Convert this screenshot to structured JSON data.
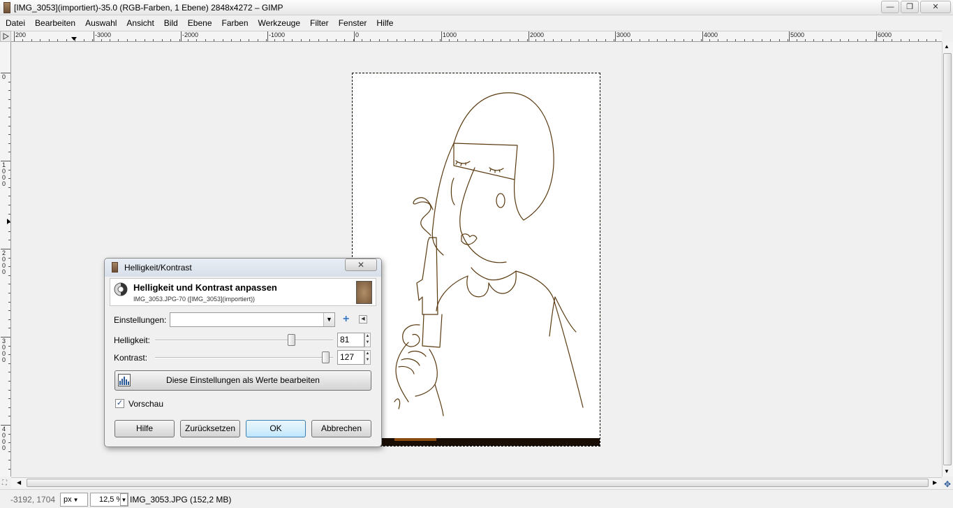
{
  "window": {
    "title": "[IMG_3053](importiert)-35.0 (RGB-Farben, 1 Ebene) 2848x4272 – GIMP",
    "minimize": "—",
    "maximize": "❐",
    "close": "✕"
  },
  "menu": [
    {
      "label": "Datei"
    },
    {
      "label": "Bearbeiten"
    },
    {
      "label": "Auswahl"
    },
    {
      "label": "Ansicht"
    },
    {
      "label": "Bild"
    },
    {
      "label": "Ebene"
    },
    {
      "label": "Farben"
    },
    {
      "label": "Werkzeuge"
    },
    {
      "label": "Filter"
    },
    {
      "label": "Fenster"
    },
    {
      "label": "Hilfe"
    }
  ],
  "ruler_top": [
    "200",
    "-3000",
    "-2000",
    "-1000",
    "0",
    "1000",
    "2000",
    "3000",
    "4000",
    "5000",
    "6000"
  ],
  "ruler_left": [
    "0",
    "1000",
    "2000",
    "3000",
    "4000"
  ],
  "statusbar": {
    "coords": "-3192, 1704",
    "unit": "px",
    "zoom": "12,5 %",
    "file": "IMG_3053.JPG (152,2 MB)"
  },
  "dialog": {
    "title": "Helligkeit/Kontrast",
    "close": "✕",
    "heading": "Helligkeit und Kontrast anpassen",
    "subheading": "IMG_3053.JPG-70 ([IMG_3053](importiert))",
    "settings_label": "Einstellungen:",
    "settings_value": "",
    "brightness_label": "Helligkeit:",
    "brightness_value": "81",
    "brightness_level": 0.81,
    "contrast_label": "Kontrast:",
    "contrast_value": "127",
    "contrast_level": 1.0,
    "edit_values_label": "Diese Einstellungen als Werte bearbeiten",
    "preview_label": "Vorschau",
    "preview_checked": true,
    "buttons": {
      "help": "Hilfe",
      "reset": "Zurücksetzen",
      "ok": "OK",
      "cancel": "Abbrechen"
    }
  },
  "colors": {
    "selection_marching_ants": "#b69b00",
    "line_art": "#5a3a10",
    "default_button_border": "#3c7fb1"
  }
}
